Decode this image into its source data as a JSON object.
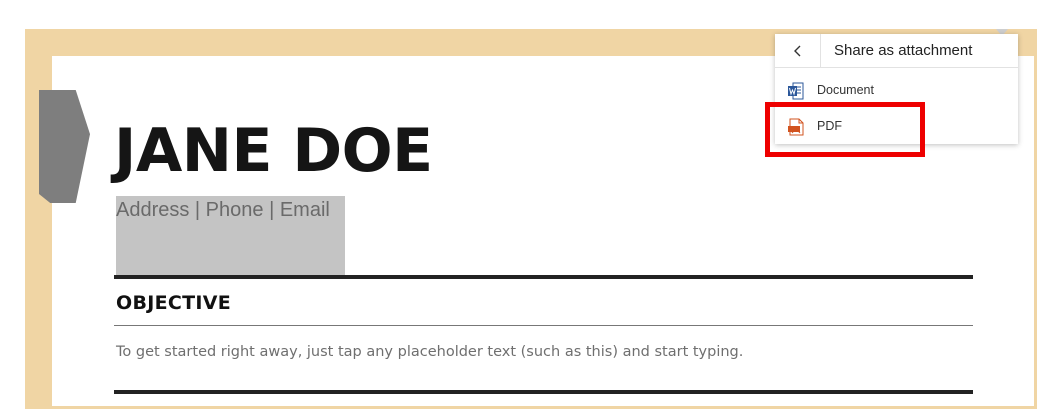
{
  "document": {
    "name": "JANE DOE",
    "contact": "Address | Phone | Email",
    "objective_heading": "OBJECTIVE",
    "objective_text": "To get started right away, just tap any placeholder text (such as this) and start typing."
  },
  "share_menu": {
    "back_icon": "chevron-left-icon",
    "title": "Share as attachment",
    "items": [
      {
        "label": "Document",
        "icon": "word-document-icon"
      },
      {
        "label": "PDF",
        "icon": "pdf-file-icon"
      }
    ]
  },
  "colors": {
    "frame": "#f0d5a4",
    "highlight": "#ee0000",
    "word_blue": "#2b579a",
    "pdf_orange": "#d2531f"
  }
}
